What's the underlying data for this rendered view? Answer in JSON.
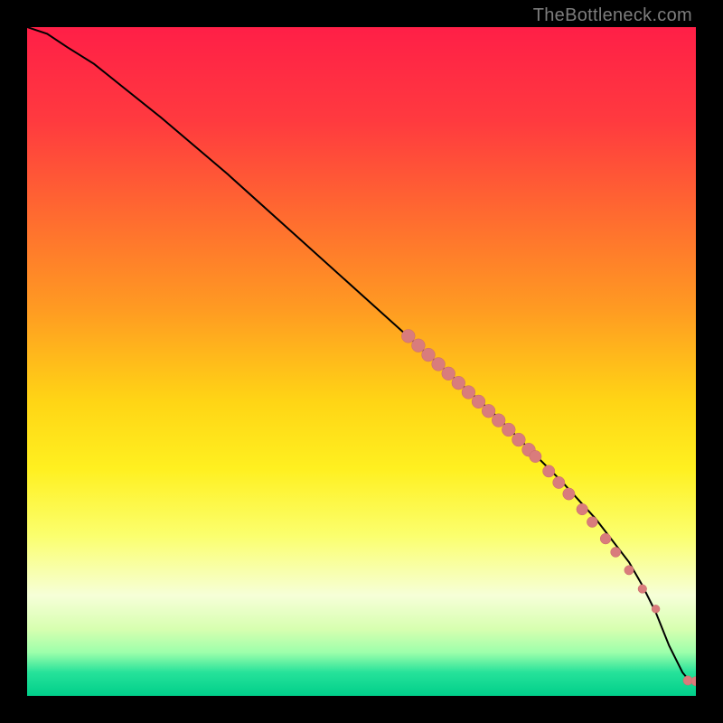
{
  "watermark": "TheBottleneck.com",
  "colors": {
    "gradient_stops": [
      {
        "offset": 0.0,
        "color": "#ff1f47"
      },
      {
        "offset": 0.14,
        "color": "#ff3a3f"
      },
      {
        "offset": 0.28,
        "color": "#ff6a30"
      },
      {
        "offset": 0.42,
        "color": "#ff9a22"
      },
      {
        "offset": 0.56,
        "color": "#ffd515"
      },
      {
        "offset": 0.66,
        "color": "#fff020"
      },
      {
        "offset": 0.76,
        "color": "#fbff6d"
      },
      {
        "offset": 0.85,
        "color": "#f6ffd8"
      },
      {
        "offset": 0.9,
        "color": "#d7ffb0"
      },
      {
        "offset": 0.935,
        "color": "#9dffab"
      },
      {
        "offset": 0.965,
        "color": "#26e29a"
      },
      {
        "offset": 1.0,
        "color": "#00cf8a"
      }
    ],
    "curve": "#000000",
    "marker_fill": "#d97c7c",
    "marker_stroke": "#c96a6a"
  },
  "chart_data": {
    "type": "line",
    "title": "",
    "xlabel": "",
    "ylabel": "",
    "xlim": [
      0,
      100
    ],
    "ylim": [
      0,
      100
    ],
    "grid": false,
    "x": [
      0,
      3,
      6,
      10,
      20,
      30,
      40,
      50,
      60,
      70,
      80,
      85,
      90,
      92,
      94,
      96,
      98,
      99,
      100
    ],
    "values": [
      100,
      99,
      97,
      94.5,
      86.5,
      78,
      69,
      60,
      51,
      42,
      32,
      26.5,
      20,
      16.5,
      12.5,
      7.5,
      3.5,
      2.3,
      2.2
    ],
    "markers": {
      "x": [
        57,
        58.5,
        60,
        61.5,
        63,
        64.5,
        66,
        67.5,
        69,
        70.5,
        72,
        73.5,
        75,
        76,
        78,
        79.5,
        81,
        83,
        84.5,
        86.5,
        88,
        90,
        92,
        94,
        98.8,
        100
      ],
      "y": [
        53.8,
        52.4,
        51.0,
        49.6,
        48.2,
        46.8,
        45.4,
        44.0,
        42.6,
        41.2,
        39.8,
        38.3,
        36.8,
        35.8,
        33.6,
        31.9,
        30.2,
        27.9,
        26.0,
        23.5,
        21.5,
        18.8,
        16.0,
        13.0,
        2.3,
        2.2
      ],
      "r": [
        1.0,
        1.0,
        1.0,
        1.0,
        1.0,
        1.0,
        1.0,
        1.0,
        1.0,
        1.0,
        1.0,
        1.0,
        1.0,
        0.9,
        0.9,
        0.9,
        0.9,
        0.85,
        0.8,
        0.8,
        0.75,
        0.7,
        0.65,
        0.6,
        0.7,
        0.7
      ]
    }
  }
}
